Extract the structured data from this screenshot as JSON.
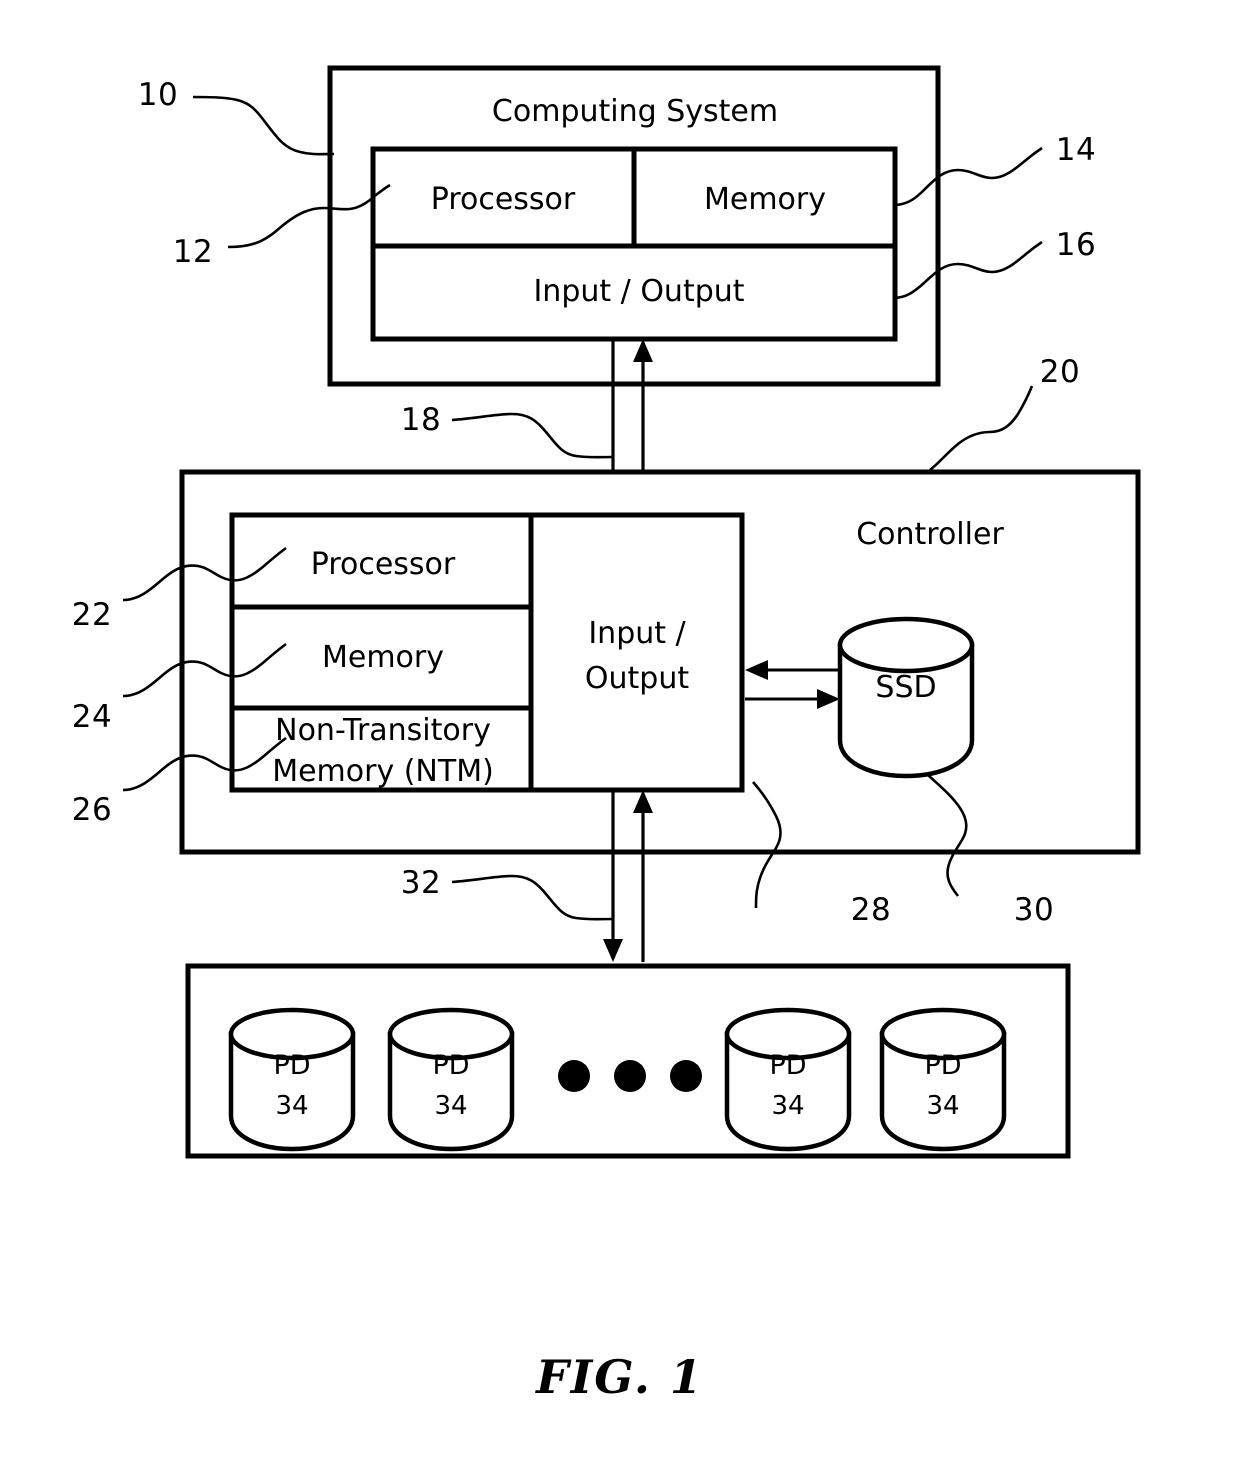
{
  "figure": {
    "caption": "FIG. 1"
  },
  "computing_system": {
    "title": "Computing System",
    "ref": "10",
    "blocks": {
      "processor": {
        "label": "Processor",
        "ref": "12"
      },
      "memory": {
        "label": "Memory",
        "ref": "14"
      },
      "io": {
        "label": "Input / Output",
        "ref": "16"
      }
    }
  },
  "bus_top": {
    "ref": "18"
  },
  "controller": {
    "title": "Controller",
    "ref": "20",
    "blocks": {
      "processor": {
        "label": "Processor",
        "ref": "22"
      },
      "memory": {
        "label": "Memory",
        "ref": "24"
      },
      "ntm": {
        "label_line1": "Non-Transitory",
        "label_line2": "Memory (NTM)",
        "ref": "26"
      },
      "io": {
        "label_line1": "Input /",
        "label_line2": "Output",
        "ref": "28"
      }
    },
    "ssd": {
      "label": "SSD",
      "ref": "30"
    }
  },
  "bus_bottom": {
    "ref": "32"
  },
  "disk_array": {
    "drives": [
      {
        "label": "PD",
        "ref": "34"
      },
      {
        "label": "PD",
        "ref": "34"
      },
      {
        "label": "PD",
        "ref": "34"
      },
      {
        "label": "PD",
        "ref": "34"
      }
    ],
    "ellipsis_dots": 3
  },
  "style": {
    "stroke": "#000000",
    "fill": "#ffffff"
  }
}
